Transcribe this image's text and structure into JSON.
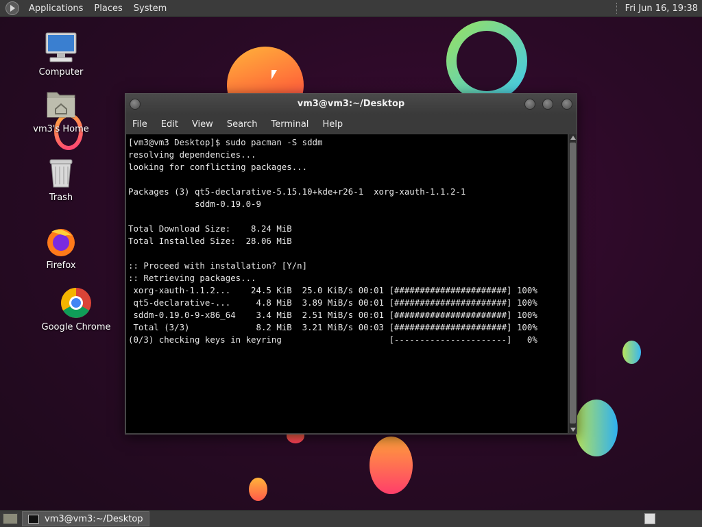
{
  "top_panel": {
    "menus": [
      "Applications",
      "Places",
      "System"
    ],
    "clock": "Fri Jun 16, 19:38"
  },
  "desktop_icons": [
    {
      "label": "Computer",
      "icon": "computer-icon"
    },
    {
      "label": "vm3's Home",
      "icon": "home-folder-icon"
    },
    {
      "label": "Trash",
      "icon": "trash-icon"
    },
    {
      "label": "Firefox",
      "icon": "firefox-icon"
    },
    {
      "label": "Google Chrome",
      "icon": "chrome-icon"
    }
  ],
  "terminal": {
    "title": "vm3@vm3:~/Desktop",
    "menu": [
      "File",
      "Edit",
      "View",
      "Search",
      "Terminal",
      "Help"
    ],
    "lines": [
      "[vm3@vm3 Desktop]$ sudo pacman -S sddm",
      "resolving dependencies...",
      "looking for conflicting packages...",
      "",
      "Packages (3) qt5-declarative-5.15.10+kde+r26-1  xorg-xauth-1.1.2-1",
      "             sddm-0.19.0-9",
      "",
      "Total Download Size:    8.24 MiB",
      "Total Installed Size:  28.06 MiB",
      "",
      ":: Proceed with installation? [Y/n]",
      ":: Retrieving packages...",
      " xorg-xauth-1.1.2...    24.5 KiB  25.0 KiB/s 00:01 [######################] 100%",
      " qt5-declarative-...     4.8 MiB  3.89 MiB/s 00:01 [######################] 100%",
      " sddm-0.19.0-9-x86_64    3.4 MiB  2.51 MiB/s 00:01 [######################] 100%",
      " Total (3/3)             8.2 MiB  3.21 MiB/s 00:03 [######################] 100%",
      "(0/3) checking keys in keyring                     [----------------------]   0%"
    ]
  },
  "taskbar": {
    "tasks": [
      {
        "label": "vm3@vm3:~/Desktop",
        "icon": "terminal-icon"
      }
    ]
  }
}
